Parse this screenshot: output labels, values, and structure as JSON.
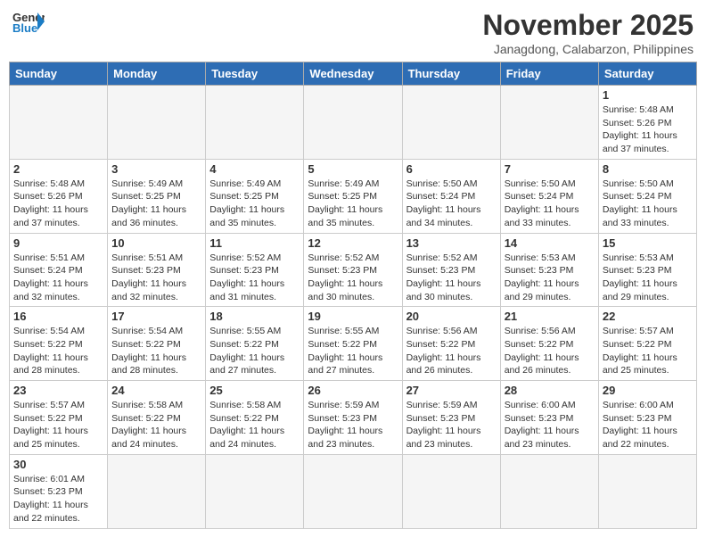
{
  "header": {
    "logo_general": "General",
    "logo_blue": "Blue",
    "month_title": "November 2025",
    "location": "Janagdong, Calabarzon, Philippines"
  },
  "weekdays": [
    "Sunday",
    "Monday",
    "Tuesday",
    "Wednesday",
    "Thursday",
    "Friday",
    "Saturday"
  ],
  "weeks": [
    [
      {
        "day": "",
        "info": ""
      },
      {
        "day": "",
        "info": ""
      },
      {
        "day": "",
        "info": ""
      },
      {
        "day": "",
        "info": ""
      },
      {
        "day": "",
        "info": ""
      },
      {
        "day": "",
        "info": ""
      },
      {
        "day": "1",
        "info": "Sunrise: 5:48 AM\nSunset: 5:26 PM\nDaylight: 11 hours\nand 37 minutes."
      }
    ],
    [
      {
        "day": "2",
        "info": "Sunrise: 5:48 AM\nSunset: 5:26 PM\nDaylight: 11 hours\nand 37 minutes."
      },
      {
        "day": "3",
        "info": "Sunrise: 5:49 AM\nSunset: 5:25 PM\nDaylight: 11 hours\nand 36 minutes."
      },
      {
        "day": "4",
        "info": "Sunrise: 5:49 AM\nSunset: 5:25 PM\nDaylight: 11 hours\nand 35 minutes."
      },
      {
        "day": "5",
        "info": "Sunrise: 5:49 AM\nSunset: 5:25 PM\nDaylight: 11 hours\nand 35 minutes."
      },
      {
        "day": "6",
        "info": "Sunrise: 5:50 AM\nSunset: 5:24 PM\nDaylight: 11 hours\nand 34 minutes."
      },
      {
        "day": "7",
        "info": "Sunrise: 5:50 AM\nSunset: 5:24 PM\nDaylight: 11 hours\nand 33 minutes."
      },
      {
        "day": "8",
        "info": "Sunrise: 5:50 AM\nSunset: 5:24 PM\nDaylight: 11 hours\nand 33 minutes."
      }
    ],
    [
      {
        "day": "9",
        "info": "Sunrise: 5:51 AM\nSunset: 5:24 PM\nDaylight: 11 hours\nand 32 minutes."
      },
      {
        "day": "10",
        "info": "Sunrise: 5:51 AM\nSunset: 5:23 PM\nDaylight: 11 hours\nand 32 minutes."
      },
      {
        "day": "11",
        "info": "Sunrise: 5:52 AM\nSunset: 5:23 PM\nDaylight: 11 hours\nand 31 minutes."
      },
      {
        "day": "12",
        "info": "Sunrise: 5:52 AM\nSunset: 5:23 PM\nDaylight: 11 hours\nand 30 minutes."
      },
      {
        "day": "13",
        "info": "Sunrise: 5:52 AM\nSunset: 5:23 PM\nDaylight: 11 hours\nand 30 minutes."
      },
      {
        "day": "14",
        "info": "Sunrise: 5:53 AM\nSunset: 5:23 PM\nDaylight: 11 hours\nand 29 minutes."
      },
      {
        "day": "15",
        "info": "Sunrise: 5:53 AM\nSunset: 5:23 PM\nDaylight: 11 hours\nand 29 minutes."
      }
    ],
    [
      {
        "day": "16",
        "info": "Sunrise: 5:54 AM\nSunset: 5:22 PM\nDaylight: 11 hours\nand 28 minutes."
      },
      {
        "day": "17",
        "info": "Sunrise: 5:54 AM\nSunset: 5:22 PM\nDaylight: 11 hours\nand 28 minutes."
      },
      {
        "day": "18",
        "info": "Sunrise: 5:55 AM\nSunset: 5:22 PM\nDaylight: 11 hours\nand 27 minutes."
      },
      {
        "day": "19",
        "info": "Sunrise: 5:55 AM\nSunset: 5:22 PM\nDaylight: 11 hours\nand 27 minutes."
      },
      {
        "day": "20",
        "info": "Sunrise: 5:56 AM\nSunset: 5:22 PM\nDaylight: 11 hours\nand 26 minutes."
      },
      {
        "day": "21",
        "info": "Sunrise: 5:56 AM\nSunset: 5:22 PM\nDaylight: 11 hours\nand 26 minutes."
      },
      {
        "day": "22",
        "info": "Sunrise: 5:57 AM\nSunset: 5:22 PM\nDaylight: 11 hours\nand 25 minutes."
      }
    ],
    [
      {
        "day": "23",
        "info": "Sunrise: 5:57 AM\nSunset: 5:22 PM\nDaylight: 11 hours\nand 25 minutes."
      },
      {
        "day": "24",
        "info": "Sunrise: 5:58 AM\nSunset: 5:22 PM\nDaylight: 11 hours\nand 24 minutes."
      },
      {
        "day": "25",
        "info": "Sunrise: 5:58 AM\nSunset: 5:22 PM\nDaylight: 11 hours\nand 24 minutes."
      },
      {
        "day": "26",
        "info": "Sunrise: 5:59 AM\nSunset: 5:23 PM\nDaylight: 11 hours\nand 23 minutes."
      },
      {
        "day": "27",
        "info": "Sunrise: 5:59 AM\nSunset: 5:23 PM\nDaylight: 11 hours\nand 23 minutes."
      },
      {
        "day": "28",
        "info": "Sunrise: 6:00 AM\nSunset: 5:23 PM\nDaylight: 11 hours\nand 23 minutes."
      },
      {
        "day": "29",
        "info": "Sunrise: 6:00 AM\nSunset: 5:23 PM\nDaylight: 11 hours\nand 22 minutes."
      }
    ],
    [
      {
        "day": "30",
        "info": "Sunrise: 6:01 AM\nSunset: 5:23 PM\nDaylight: 11 hours\nand 22 minutes."
      },
      {
        "day": "",
        "info": ""
      },
      {
        "day": "",
        "info": ""
      },
      {
        "day": "",
        "info": ""
      },
      {
        "day": "",
        "info": ""
      },
      {
        "day": "",
        "info": ""
      },
      {
        "day": "",
        "info": ""
      }
    ]
  ]
}
